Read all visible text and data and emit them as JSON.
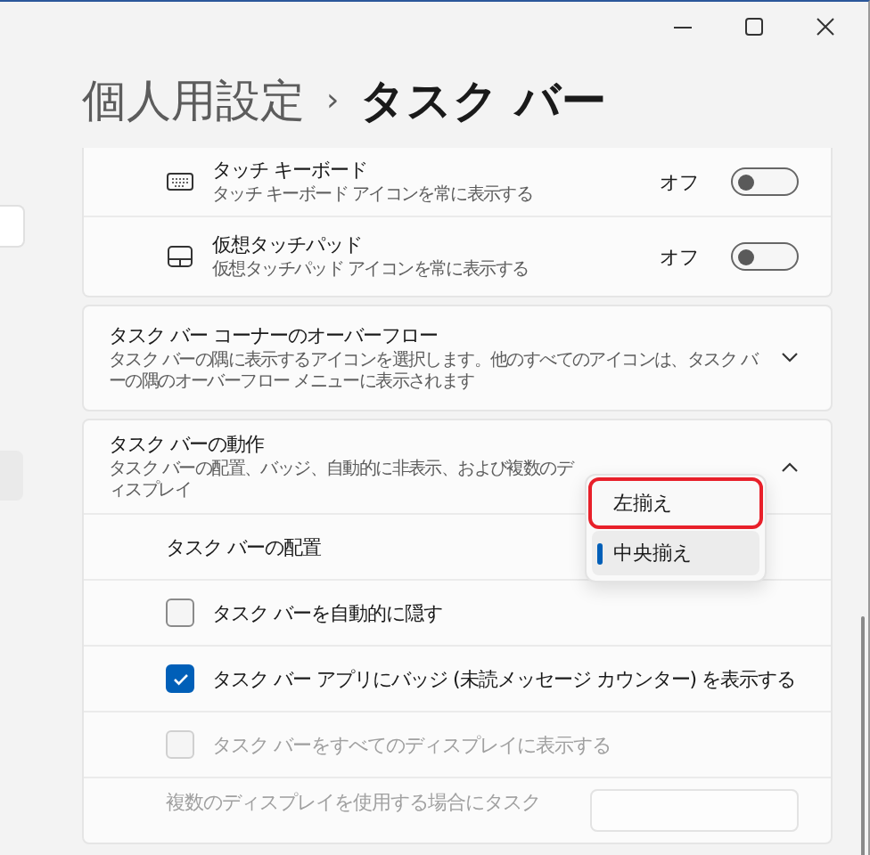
{
  "breadcrumb": {
    "parent": "個人用設定",
    "separator": "›",
    "current": "タスク バー"
  },
  "toggle_rows": [
    {
      "title": "タッチ キーボード",
      "description": "タッチ キーボード アイコンを常に表示する",
      "state_label": "オフ",
      "on": false
    },
    {
      "title": "仮想タッチパッド",
      "description": "仮想タッチパッド アイコンを常に表示する",
      "state_label": "オフ",
      "on": false
    }
  ],
  "overflow_card": {
    "title": "タスク バー コーナーのオーバーフロー",
    "description": "タスク バーの隅に表示するアイコンを選択します。他のすべてのアイコンは、タスク バーの隅のオーバーフロー メニューに表示されます",
    "expanded": false
  },
  "behavior_card": {
    "title": "タスク バーの動作",
    "description": "タスク バーの配置、バッジ、自動的に非表示、および複数のディスプレイ",
    "expanded": true
  },
  "alignment": {
    "label": "タスク バーの配置",
    "options": [
      {
        "label": "左揃え",
        "selected": false,
        "highlighted": true
      },
      {
        "label": "中央揃え",
        "selected": true,
        "highlighted": false
      }
    ]
  },
  "checkbox_rows": [
    {
      "label": "タスク バーを自動的に隠す",
      "checked": false,
      "disabled": false
    },
    {
      "label": "タスク バー アプリにバッジ (未読メッセージ カウンター) を表示する",
      "checked": true,
      "disabled": false
    },
    {
      "label": "タスク バーをすべてのディスプレイに表示する",
      "checked": false,
      "disabled": true
    }
  ],
  "multi_display": {
    "label": "複数のディスプレイを使用する場合にタスク",
    "disabled": true
  }
}
